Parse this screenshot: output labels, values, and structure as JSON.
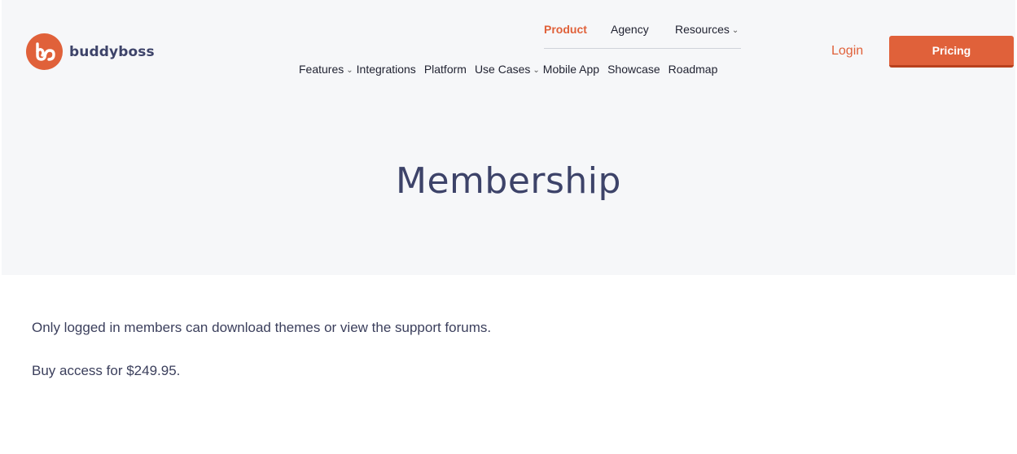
{
  "brand": {
    "name": "buddyboss",
    "icon": "buddyboss-logo-icon",
    "accent_color": "#e0613a",
    "text_color": "#3d4369"
  },
  "nav_top": [
    {
      "label": "Product",
      "active": true
    },
    {
      "label": "Agency",
      "active": false
    },
    {
      "label": "Resources",
      "has_dropdown": true
    }
  ],
  "nav_main": [
    {
      "label": "Features",
      "has_dropdown": true
    },
    {
      "label": "Integrations"
    },
    {
      "label": "Platform"
    },
    {
      "label": "Use Cases",
      "has_dropdown": true
    },
    {
      "label": "Mobile App"
    },
    {
      "label": "Showcase"
    },
    {
      "label": "Roadmap"
    }
  ],
  "header_actions": {
    "login_label": "Login",
    "pricing_label": "Pricing"
  },
  "hero": {
    "title": "Membership"
  },
  "content": {
    "paragraphs": [
      "Only logged in members can download themes or view the support forums.",
      "Buy access for $249.95."
    ]
  },
  "icons": {
    "dropdown": "chevron-down-icon"
  }
}
